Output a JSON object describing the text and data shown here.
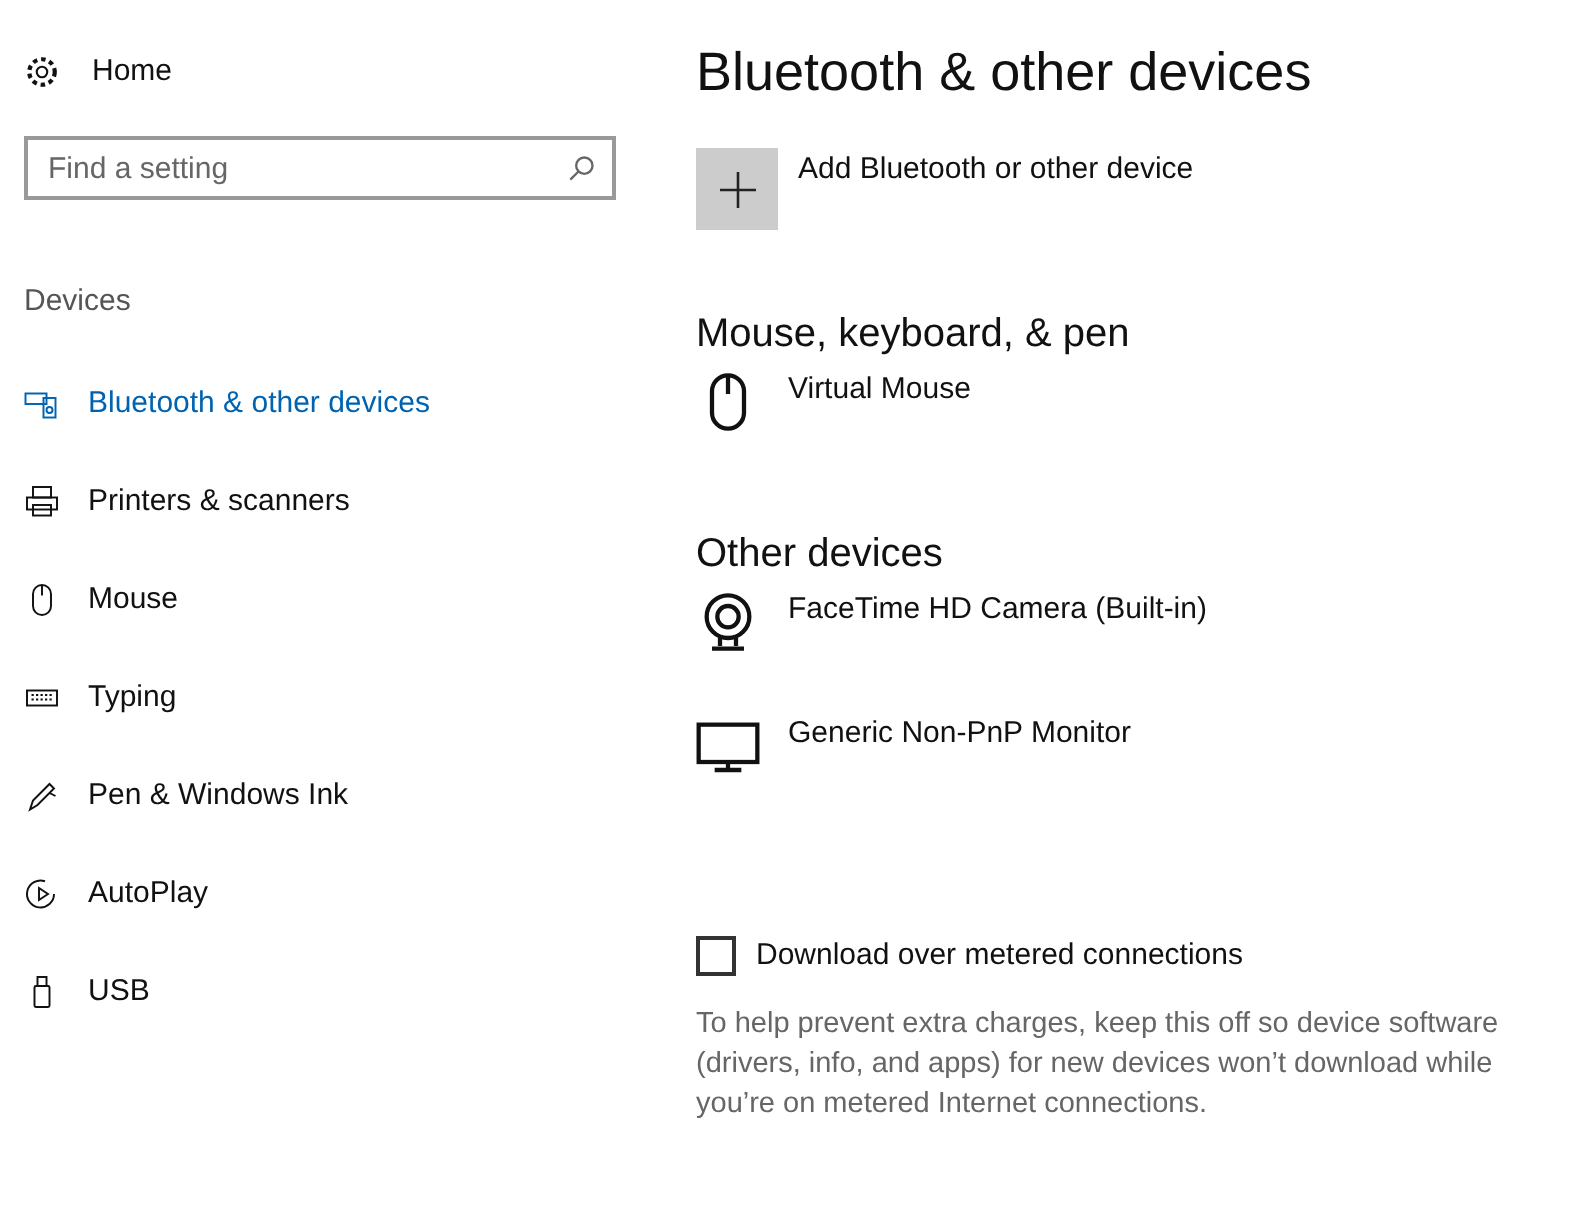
{
  "sidebar": {
    "home": "Home",
    "search": {
      "placeholder": "Find a setting"
    },
    "section": "Devices",
    "items": [
      {
        "label": "Bluetooth & other devices",
        "kind": "bluetooth",
        "selected": true
      },
      {
        "label": "Printers & scanners",
        "kind": "printer",
        "selected": false
      },
      {
        "label": "Mouse",
        "kind": "mouse",
        "selected": false
      },
      {
        "label": "Typing",
        "kind": "keyboard",
        "selected": false
      },
      {
        "label": "Pen & Windows Ink",
        "kind": "pen",
        "selected": false
      },
      {
        "label": "AutoPlay",
        "kind": "autoplay",
        "selected": false
      },
      {
        "label": "USB",
        "kind": "usb",
        "selected": false
      }
    ]
  },
  "main": {
    "title": "Bluetooth & other devices",
    "add_button": "Add Bluetooth or other device",
    "groups": [
      {
        "heading": "Mouse, keyboard, & pen",
        "devices": [
          {
            "name": "Virtual Mouse",
            "kind": "mouse"
          }
        ]
      },
      {
        "heading": "Other devices",
        "devices": [
          {
            "name": "FaceTime HD Camera (Built-in)",
            "kind": "camera"
          },
          {
            "name": "Generic Non-PnP Monitor",
            "kind": "monitor"
          }
        ]
      }
    ],
    "download_option": {
      "label": "Download over metered connections",
      "checked": false
    },
    "description": "To help prevent extra charges, keep this off so device software (drivers, info, and apps) for new devices won’t download while you’re on metered Internet connections."
  }
}
